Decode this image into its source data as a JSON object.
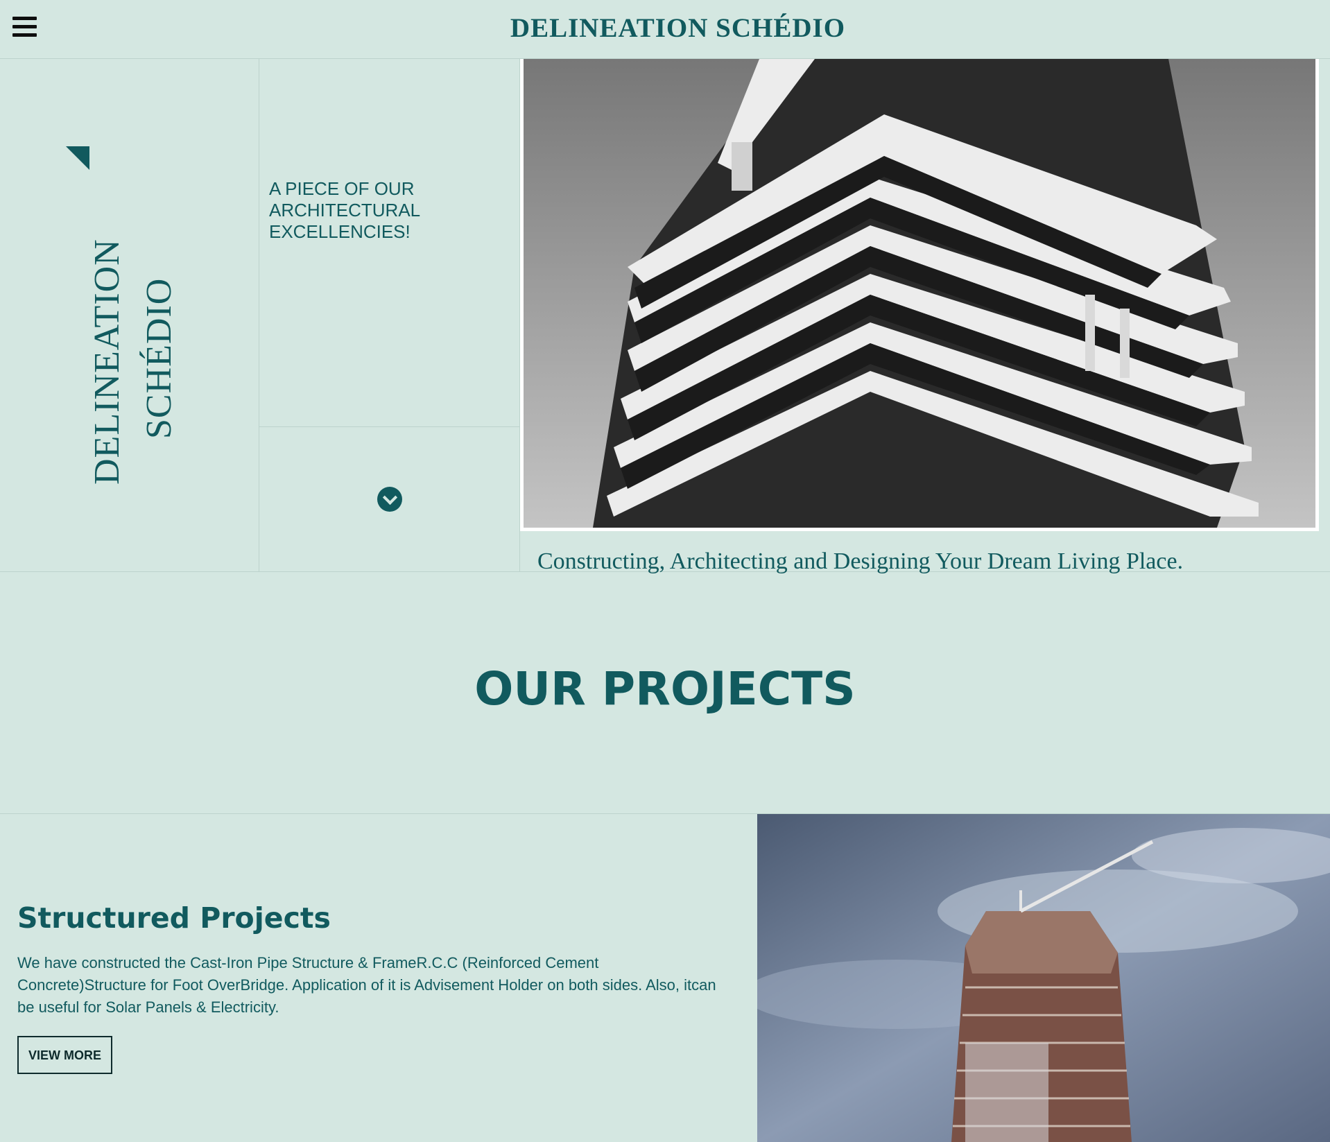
{
  "header": {
    "brand": "DELINEATION SCHÉDIO",
    "menu_icon": "hamburger-menu-icon"
  },
  "hero": {
    "logo_word_1": "DELINEATION",
    "logo_word_2": "SCHÉDIO",
    "tagline": "A PIECE OF OUR ARCHITECTURAL EXCELLENCIES!",
    "scroll_icon": "chevron-down-circle-icon",
    "caption": "Constructing, Architecting and Designing Your Dream Living Place."
  },
  "projects": {
    "heading": "OUR PROJECTS",
    "items": [
      {
        "title": "Structured Projects",
        "description": "We have constructed the Cast-Iron Pipe Structure & FrameR.C.C (Reinforced Cement Concrete)Structure for Foot OverBridge. Application of it is Advisement Holder on both sides. Also, itcan be useful for Solar Panels & Electricity.",
        "button": "VIEW MORE"
      }
    ]
  },
  "colors": {
    "background": "#d4e7e1",
    "accent": "#115a5e",
    "button_border": "#0e2b2c"
  }
}
